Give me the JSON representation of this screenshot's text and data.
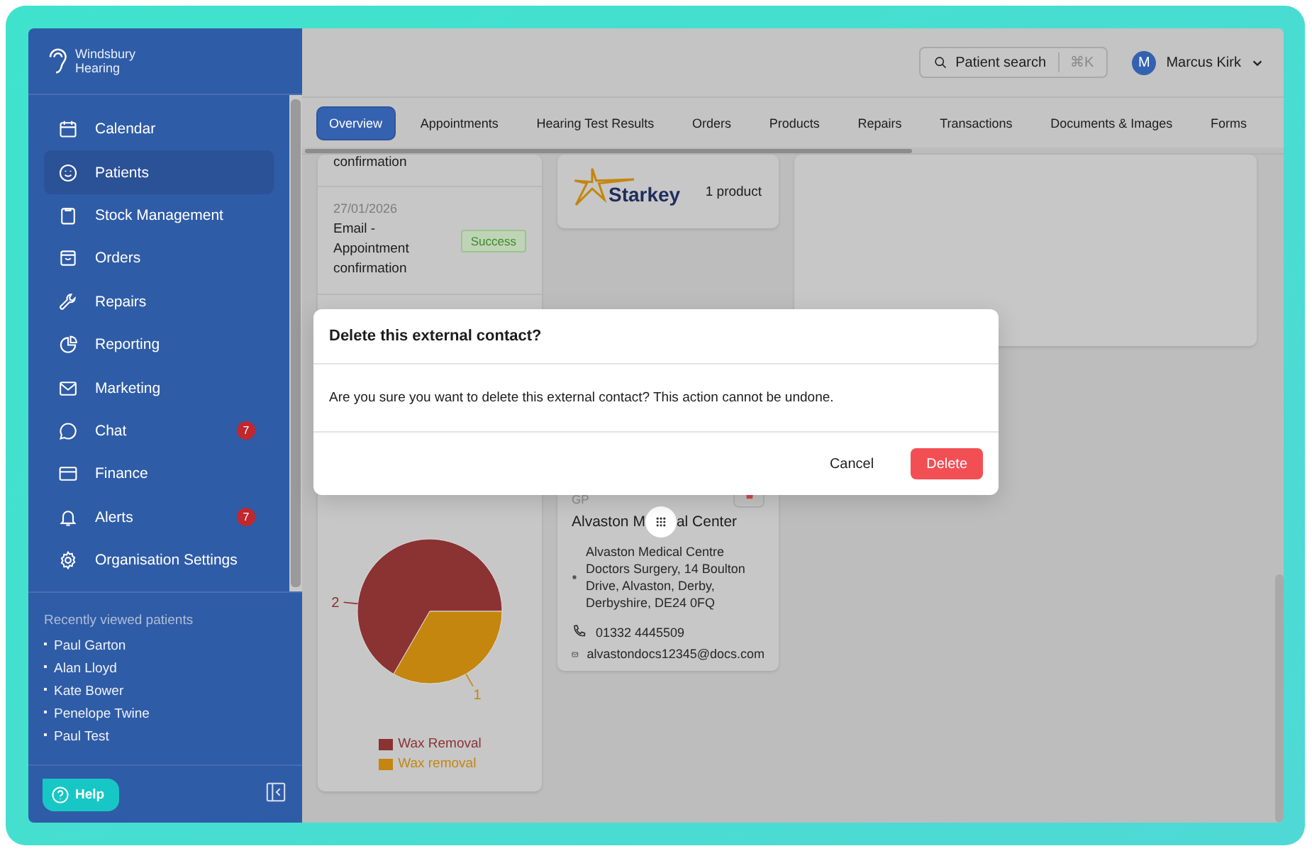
{
  "logo": {
    "lines": [
      "Windsbury",
      "Hearing"
    ]
  },
  "sidebar": {
    "items": [
      {
        "label": "Calendar",
        "selected": false
      },
      {
        "label": "Patients",
        "selected": true
      },
      {
        "label": "Stock Management",
        "selected": false
      },
      {
        "label": "Orders",
        "selected": false
      },
      {
        "label": "Repairs",
        "selected": false
      },
      {
        "label": "Reporting",
        "selected": false
      },
      {
        "label": "Marketing",
        "selected": false
      },
      {
        "label": "Chat",
        "selected": false,
        "badge": "7"
      },
      {
        "label": "Finance",
        "selected": false
      },
      {
        "label": "Alerts",
        "selected": false,
        "badge": "7"
      },
      {
        "label": "Organisation Settings",
        "selected": false
      }
    ],
    "recent_title": "Recently viewed patients",
    "recent_patients": [
      "Paul Garton",
      "Alan Lloyd",
      "Kate Bower",
      "Penelope Twine",
      "Paul Test"
    ],
    "help_button": "Help"
  },
  "header": {
    "search": {
      "label": "Patient search",
      "shortcut": "⌘K"
    },
    "user": {
      "initial": "M",
      "name": "Marcus Kirk"
    }
  },
  "tabs": [
    {
      "label": "Overview",
      "selected": true
    },
    {
      "label": "Appointments",
      "selected": false
    },
    {
      "label": "Hearing Test Results",
      "selected": false
    },
    {
      "label": "Orders",
      "selected": false
    },
    {
      "label": "Products",
      "selected": false
    },
    {
      "label": "Repairs",
      "selected": false
    },
    {
      "label": "Transactions",
      "selected": false
    },
    {
      "label": "Documents & Images",
      "selected": false
    },
    {
      "label": "Forms",
      "selected": false
    }
  ],
  "messages": [
    {
      "text": "confirmation"
    },
    {
      "date": "27/01/2026",
      "text": "Email - Appointment confirmation",
      "status": "Success"
    }
  ],
  "chart": {
    "chart_data": {
      "type": "pie",
      "categories": [
        "Wax Removal",
        "Wax removal"
      ],
      "values": [
        2,
        1
      ],
      "colors": [
        "#8b3232",
        "#c4860f"
      ],
      "value_labels": [
        "2",
        "1"
      ],
      "legend": "bottom"
    }
  },
  "products": [
    {
      "brand": "Starkey",
      "count": "1 product"
    }
  ],
  "contact": {
    "type": "GP",
    "name_parts": [
      "Alvaston M",
      "al Center"
    ],
    "address": "Alvaston Medical Centre Doctors Surgery, 14 Boulton Drive, Alvaston, Derby, Derbyshire, DE24 0FQ",
    "phone": "01332 4445509",
    "email": "alvastondocs12345@docs.com"
  },
  "dialog": {
    "title": "Delete this external contact?",
    "message": "Are you sure you want to delete this external contact? This action cannot be undone.",
    "buttons": [
      {
        "label": "Cancel",
        "kind": "secondary"
      },
      {
        "label": "Delete",
        "kind": "danger"
      }
    ]
  }
}
